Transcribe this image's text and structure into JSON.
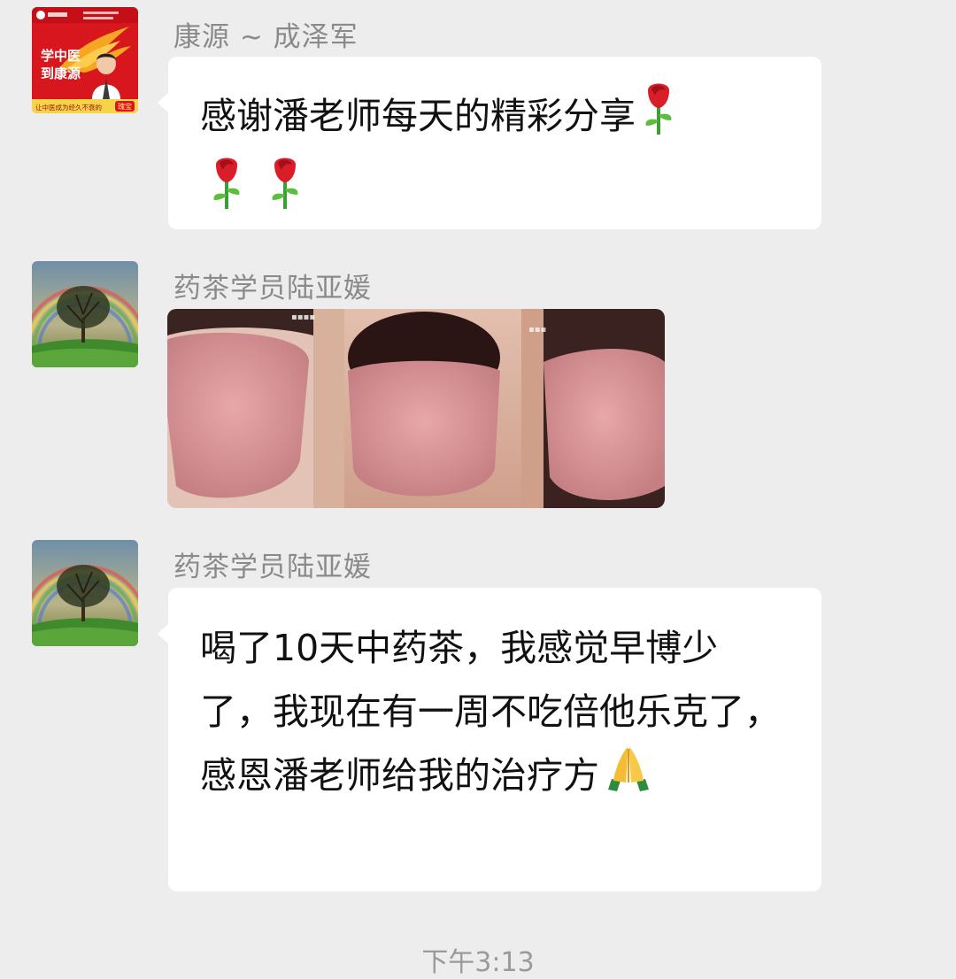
{
  "messages": [
    {
      "sender": "康源 ~ 成泽军",
      "avatar": {
        "icon": "kangyuan-logo-avatar",
        "slogan_line1": "学中医",
        "slogan_line2": "到康源",
        "bottom_text": "让中医成为经久不衰的",
        "bottom_badge": "瑰宝"
      },
      "text": "感谢潘老师每天的精彩分享",
      "emoji": [
        "rose-icon",
        "rose-icon",
        "rose-icon"
      ]
    },
    {
      "sender": "药茶学员陆亚媛",
      "avatar": {
        "icon": "rainbow-tree-avatar"
      },
      "image": {
        "icon": "tongue-comparison-photo"
      }
    },
    {
      "sender": "药茶学员陆亚媛",
      "avatar": {
        "icon": "rainbow-tree-avatar"
      },
      "text": "喝了10天中药茶，我感觉早博少了，我现在有一周不吃倍他乐克了，感恩潘老师给我的治疗方",
      "emoji": [
        "folded-hands-icon"
      ]
    }
  ],
  "timestamp": "下午3:13",
  "colors": {
    "background": "#ededed",
    "bubble": "#ffffff",
    "sender_name": "#8a8a8a"
  }
}
